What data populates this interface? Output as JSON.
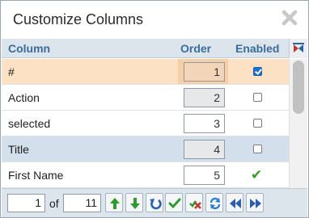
{
  "dialog": {
    "title": "Customize Columns",
    "close_icon": "close-icon"
  },
  "grid": {
    "headers": {
      "column": "Column",
      "order": "Order",
      "enabled": "Enabled"
    },
    "corner_icon": "column-settings-icon",
    "rows": [
      {
        "name": "#",
        "order": "1",
        "enabled": "checked",
        "order_editable": false,
        "highlight": "orange"
      },
      {
        "name": "Action",
        "order": "2",
        "enabled": "unchecked",
        "order_editable": false,
        "highlight": "none"
      },
      {
        "name": "selected",
        "order": "3",
        "enabled": "unchecked",
        "order_editable": true,
        "highlight": "none"
      },
      {
        "name": "Title",
        "order": "4",
        "enabled": "unchecked",
        "order_editable": false,
        "highlight": "blue"
      },
      {
        "name": "First Name",
        "order": "5",
        "enabled": "tick",
        "order_editable": true,
        "highlight": "none"
      }
    ]
  },
  "pager": {
    "current_page": "1",
    "of_label": "of",
    "total_pages": "11",
    "buttons": [
      {
        "name": "move-up-button",
        "icon": "arrow-up-icon",
        "color": "#2e9b2e"
      },
      {
        "name": "move-down-button",
        "icon": "arrow-down-icon",
        "color": "#2e9b2e"
      },
      {
        "name": "reset-button",
        "icon": "undo-icon",
        "color": "#2a5fb0"
      },
      {
        "name": "select-all-button",
        "icon": "check-icon",
        "color": "#2e9b2e"
      },
      {
        "name": "deselect-all-button",
        "icon": "uncheck-icon",
        "color": "#c0392b"
      },
      {
        "name": "refresh-button",
        "icon": "refresh-icon",
        "color": "#2a7fd0"
      },
      {
        "name": "previous-page-button",
        "icon": "double-left-icon",
        "color": "#2a5fb0"
      },
      {
        "name": "next-page-button",
        "icon": "double-right-icon",
        "color": "#2a5fb0"
      }
    ]
  },
  "colors": {
    "header_text": "#3a6d9a",
    "header_bg": "#dce4ec",
    "row_highlight_orange": "#fde1c4",
    "row_highlight_blue": "#d3dfea"
  }
}
